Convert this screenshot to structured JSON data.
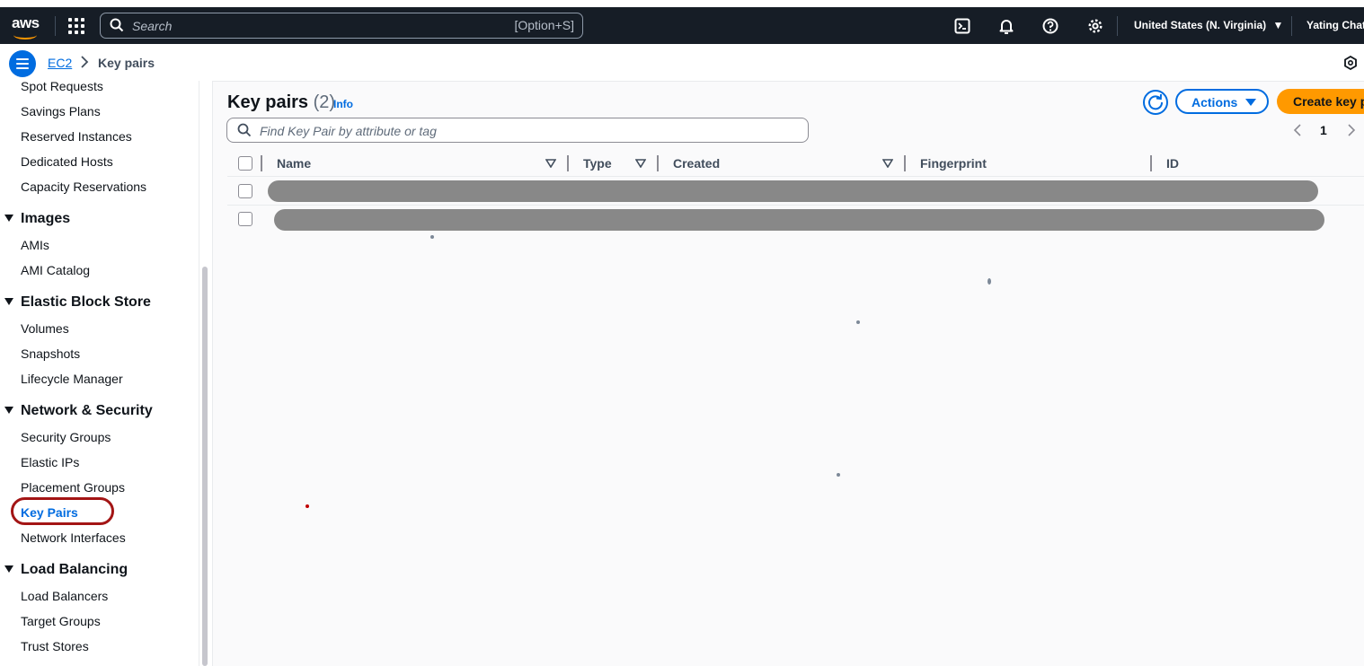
{
  "topbar": {
    "logo_text": "aws",
    "search_placeholder": "Search",
    "search_shortcut": "[Option+S]",
    "region": "United States (N. Virginia)",
    "user": "Yating Chat",
    "icons": [
      "cloudshell-icon",
      "bell-icon",
      "help-icon",
      "gear-icon"
    ]
  },
  "breadcrumb": {
    "service": "EC2",
    "current": "Key pairs"
  },
  "sidebar": {
    "items_top": [
      "Spot Requests",
      "Savings Plans",
      "Reserved Instances",
      "Dedicated Hosts",
      "Capacity Reservations"
    ],
    "sections": [
      {
        "title": "Images",
        "items": [
          "AMIs",
          "AMI Catalog"
        ]
      },
      {
        "title": "Elastic Block Store",
        "items": [
          "Volumes",
          "Snapshots",
          "Lifecycle Manager"
        ]
      },
      {
        "title": "Network & Security",
        "items": [
          "Security Groups",
          "Elastic IPs",
          "Placement Groups",
          "Key Pairs",
          "Network Interfaces"
        ]
      },
      {
        "title": "Load Balancing",
        "items": [
          "Load Balancers",
          "Target Groups",
          "Trust Stores"
        ]
      }
    ],
    "active_item": "Key Pairs"
  },
  "main": {
    "title": "Key pairs",
    "count": "(2)",
    "info": "Info",
    "actions_label": "Actions",
    "create_label": "Create key pair",
    "filter_placeholder": "Find Key Pair by attribute or tag",
    "page": "1",
    "columns": [
      "Name",
      "Type",
      "Created",
      "Fingerprint",
      "ID"
    ]
  },
  "colors": {
    "topbar_bg": "#161d26",
    "accent_blue": "#006ce0",
    "create_orange": "#ff9900",
    "highlight_ring": "#a31515",
    "redaction_gray": "#888888"
  }
}
